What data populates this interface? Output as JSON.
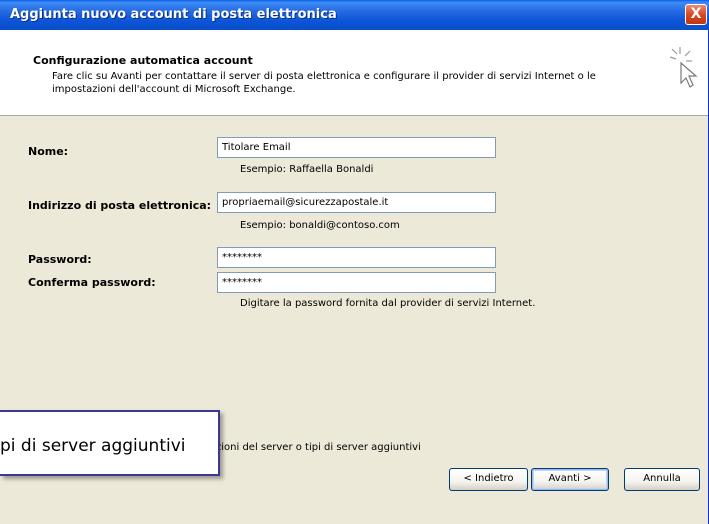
{
  "window": {
    "title": "Aggiunta nuovo account di posta elettronica",
    "close_label": "X"
  },
  "header": {
    "title": "Configurazione automatica account",
    "description": "Fare clic su Avanti per contattare il server di posta elettronica e configurare il provider di servizi Internet o le impostazioni dell'account di Microsoft Exchange."
  },
  "form": {
    "name_label": "Nome:",
    "name_value": "Titolare Email",
    "name_hint": "Esempio: Raffaella Bonaldi",
    "email_label": "Indirizzo di posta elettronica:",
    "email_value": "propriaemail@sicurezzapostale.it",
    "email_hint": "Esempio: bonaldi@contoso.com",
    "password_label": "Password:",
    "password_value": "********",
    "confirm_label": "Conferma password:",
    "confirm_value": "********",
    "password_hint": "Digitare la password fornita dal provider di servizi Internet."
  },
  "manual_option": {
    "partial_text": "zioni del server o tipi di server aggiuntivi"
  },
  "tooltip": {
    "text": "pi di server aggiuntivi"
  },
  "buttons": {
    "back": "< Indietro",
    "next": "Avanti >",
    "cancel": "Annulla"
  }
}
